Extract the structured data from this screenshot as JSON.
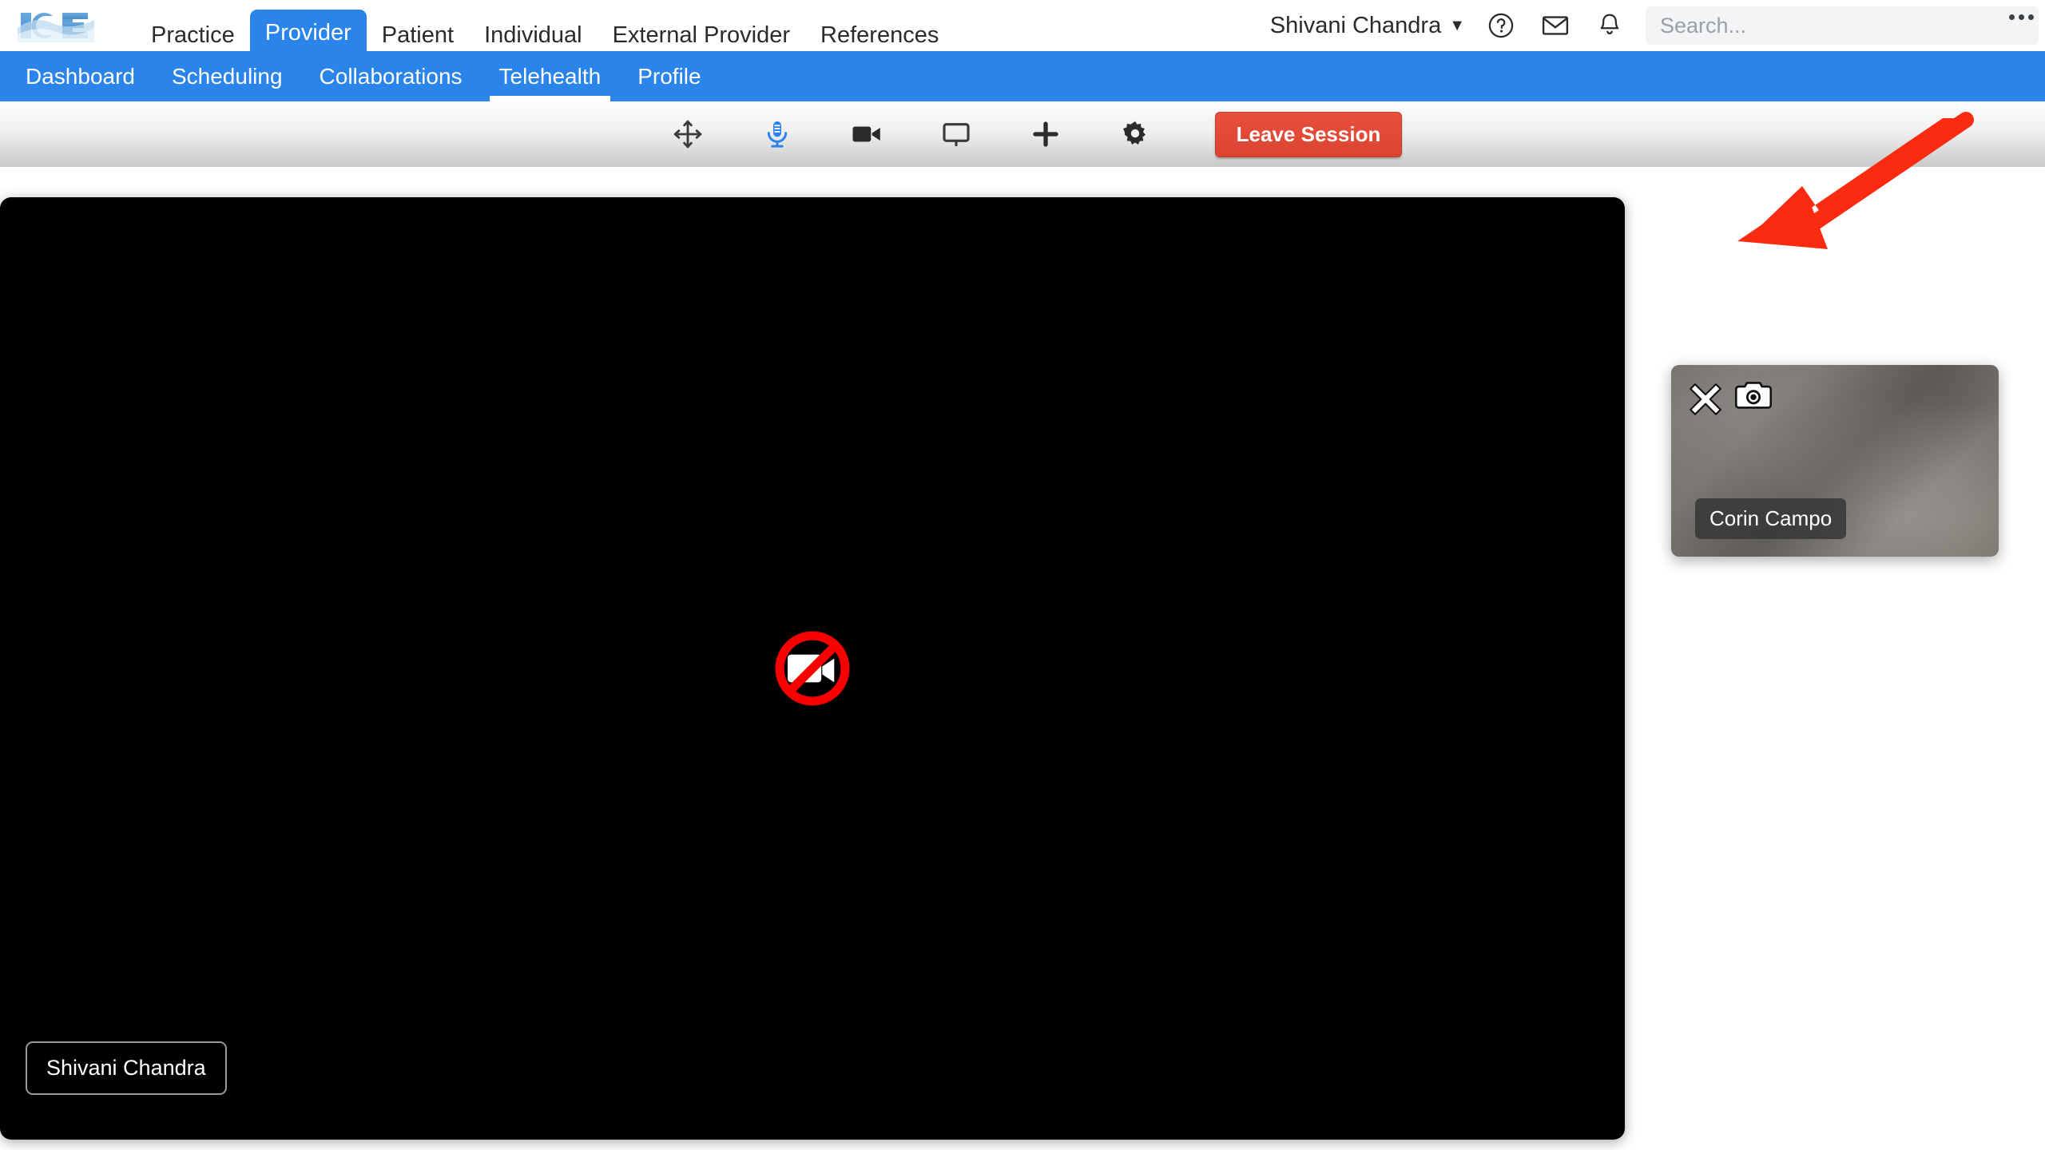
{
  "brand": {
    "logo_text": "ICE"
  },
  "primary_nav": {
    "items": [
      {
        "label": "Practice",
        "active": false
      },
      {
        "label": "Provider",
        "active": true
      },
      {
        "label": "Patient",
        "active": false
      },
      {
        "label": "Individual",
        "active": false
      },
      {
        "label": "External Provider",
        "active": false
      },
      {
        "label": "References",
        "active": false
      }
    ]
  },
  "account": {
    "user_name": "Shivani Chandra",
    "caret": "▼",
    "help_icon": "help-circle-icon",
    "mail_icon": "envelope-icon",
    "bell_icon": "notification-bell-icon"
  },
  "search": {
    "value": "",
    "placeholder": "Search..."
  },
  "overflow_menu": {
    "icon": "kebab-menu-icon"
  },
  "secondary_nav": {
    "items": [
      {
        "label": "Dashboard",
        "active": false
      },
      {
        "label": "Scheduling",
        "active": false
      },
      {
        "label": "Collaborations",
        "active": false
      },
      {
        "label": "Telehealth",
        "active": true
      },
      {
        "label": "Profile",
        "active": false
      }
    ]
  },
  "session_toolbar": {
    "buttons": [
      {
        "icon": "move-arrows-icon",
        "label": "Move",
        "state": "default"
      },
      {
        "icon": "microphone-icon",
        "label": "Microphone",
        "state": "active"
      },
      {
        "icon": "video-camera-icon",
        "label": "Camera",
        "state": "default"
      },
      {
        "icon": "screen-share-icon",
        "label": "Share Screen",
        "state": "default"
      },
      {
        "icon": "plus-icon",
        "label": "Add",
        "state": "default"
      },
      {
        "icon": "gear-icon",
        "label": "Settings",
        "state": "default"
      }
    ],
    "leave_label": "Leave Session"
  },
  "main_video": {
    "state": "no-video",
    "state_icon": "video-off-icon",
    "participant_name": "Shivani Chandra"
  },
  "pip_video": {
    "participant_name": "Corin Campo",
    "close_icon": "close-x-icon",
    "snapshot_icon": "camera-snapshot-icon"
  },
  "annotation": {
    "type": "arrow",
    "color": "#fa2b10",
    "points_to": "camera-snapshot-icon"
  },
  "colors": {
    "brand_blue": "#2a84e9",
    "leave_red": "#e0492f",
    "mic_active_blue": "#2a84e9",
    "annotation_red": "#fa2b10"
  }
}
